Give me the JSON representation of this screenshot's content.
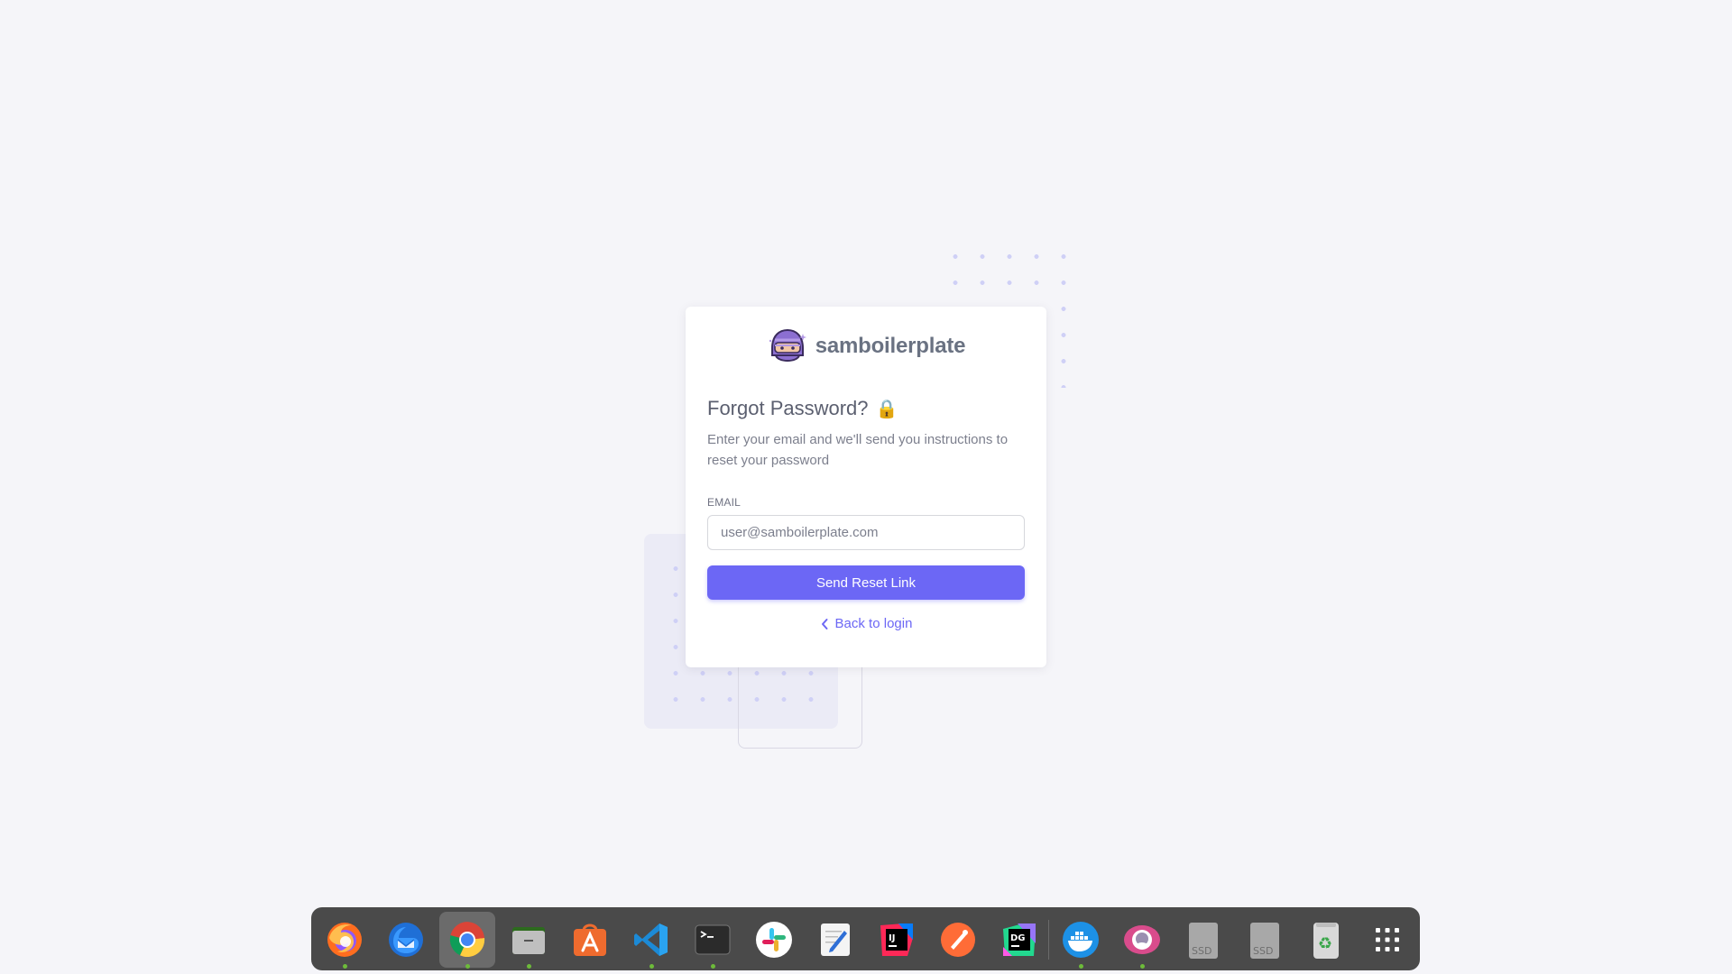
{
  "brand": {
    "name": "samboilerplate"
  },
  "form": {
    "title": "Forgot Password?",
    "title_emoji": "🔒",
    "subtitle": "Enter your email and we'll send you instructions to reset your password",
    "email_label": "EMAIL",
    "email_placeholder": "user@samboilerplate.com",
    "email_value": "",
    "submit_label": "Send Reset Link",
    "back_label": "Back to login"
  },
  "colors": {
    "accent": "#6c67f5",
    "background": "#f5f5f9",
    "dock": "#4a4a4a"
  },
  "dock": {
    "items": [
      {
        "name": "firefox-icon",
        "running": true
      },
      {
        "name": "thunderbird-icon",
        "running": false
      },
      {
        "name": "chrome-icon",
        "running": true,
        "active": true
      },
      {
        "name": "files-icon",
        "running": true
      },
      {
        "name": "app-center-icon",
        "running": false
      },
      {
        "name": "vscode-icon",
        "running": true
      },
      {
        "name": "terminal-icon",
        "running": true
      },
      {
        "name": "slack-icon",
        "running": false
      },
      {
        "name": "text-editor-icon",
        "running": false
      },
      {
        "name": "intellij-icon",
        "running": false
      },
      {
        "name": "postman-icon",
        "running": false
      },
      {
        "name": "datagrip-icon",
        "running": false
      },
      {
        "name": "docker-icon",
        "running": true
      },
      {
        "name": "gitkraken-icon",
        "running": true
      },
      {
        "name": "ssd-drive-icon",
        "label": "SSD",
        "running": false
      },
      {
        "name": "ssd-drive-icon",
        "label": "SSD",
        "running": false
      },
      {
        "name": "trash-icon",
        "running": false
      },
      {
        "name": "app-grid-icon",
        "running": false
      }
    ]
  }
}
